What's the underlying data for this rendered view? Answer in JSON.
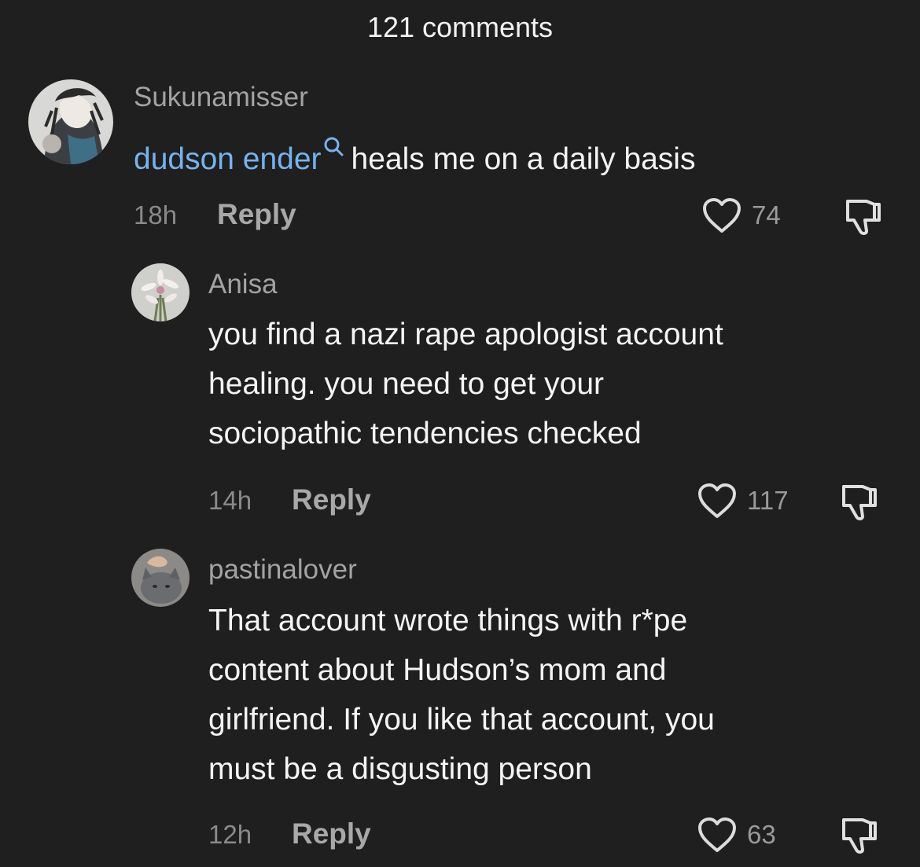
{
  "header": {
    "title": "121 comments"
  },
  "comments": [
    {
      "username": "Sukunamisser",
      "mention": "dudson ender",
      "text": "heals me on a daily basis",
      "time": "18h",
      "reply_label": "Reply",
      "likes": "74"
    },
    {
      "username": "Anisa",
      "text_lines": [
        "you find a nazi rape apologist account",
        "healing. you need to get your",
        "sociopathic tendencies checked"
      ],
      "time": "14h",
      "reply_label": "Reply",
      "likes": "117"
    },
    {
      "username": "pastinalover",
      "text_lines": [
        "That account wrote things with r*pe",
        "content about Hudson’s mom and",
        "girlfriend. If you like that account, you",
        "must be a disgusting person"
      ],
      "time": "12h",
      "reply_label": "Reply",
      "likes": "63"
    }
  ],
  "colors": {
    "background": "#1f1f1f",
    "mention": "#77b3ee",
    "username": "#a3a3a3",
    "text": "#f4f4f4"
  },
  "icons": [
    "search-icon",
    "heart-icon",
    "thumbs-down-icon"
  ]
}
